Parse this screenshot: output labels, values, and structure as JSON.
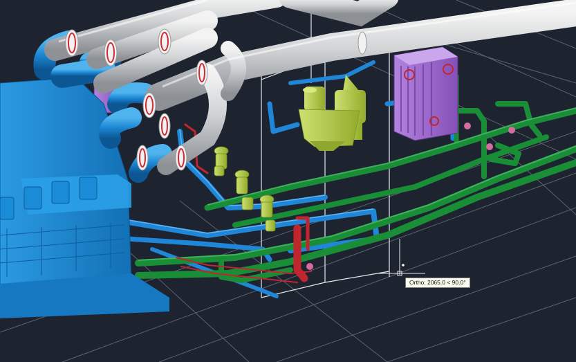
{
  "canvas": {
    "background": "#1e2330",
    "grid_color": "#6f7a86",
    "colors": {
      "exhaust_pipe": "#c8cacd",
      "cooling_water": "#1f86d8",
      "lube_oil": "#1a8e37",
      "fuel": "#c0262e",
      "engine": "#1d8dd6",
      "heat_exchanger": "#9a5fcc",
      "separator": "#aacc33",
      "valve": "#a9c25a"
    }
  },
  "status": {
    "ortho_tooltip": "Ortho: 2065.0 < 90.0°"
  },
  "icons": {
    "cursor": "crosshair-cursor-icon",
    "snap_marker": "snap-point-icon"
  }
}
